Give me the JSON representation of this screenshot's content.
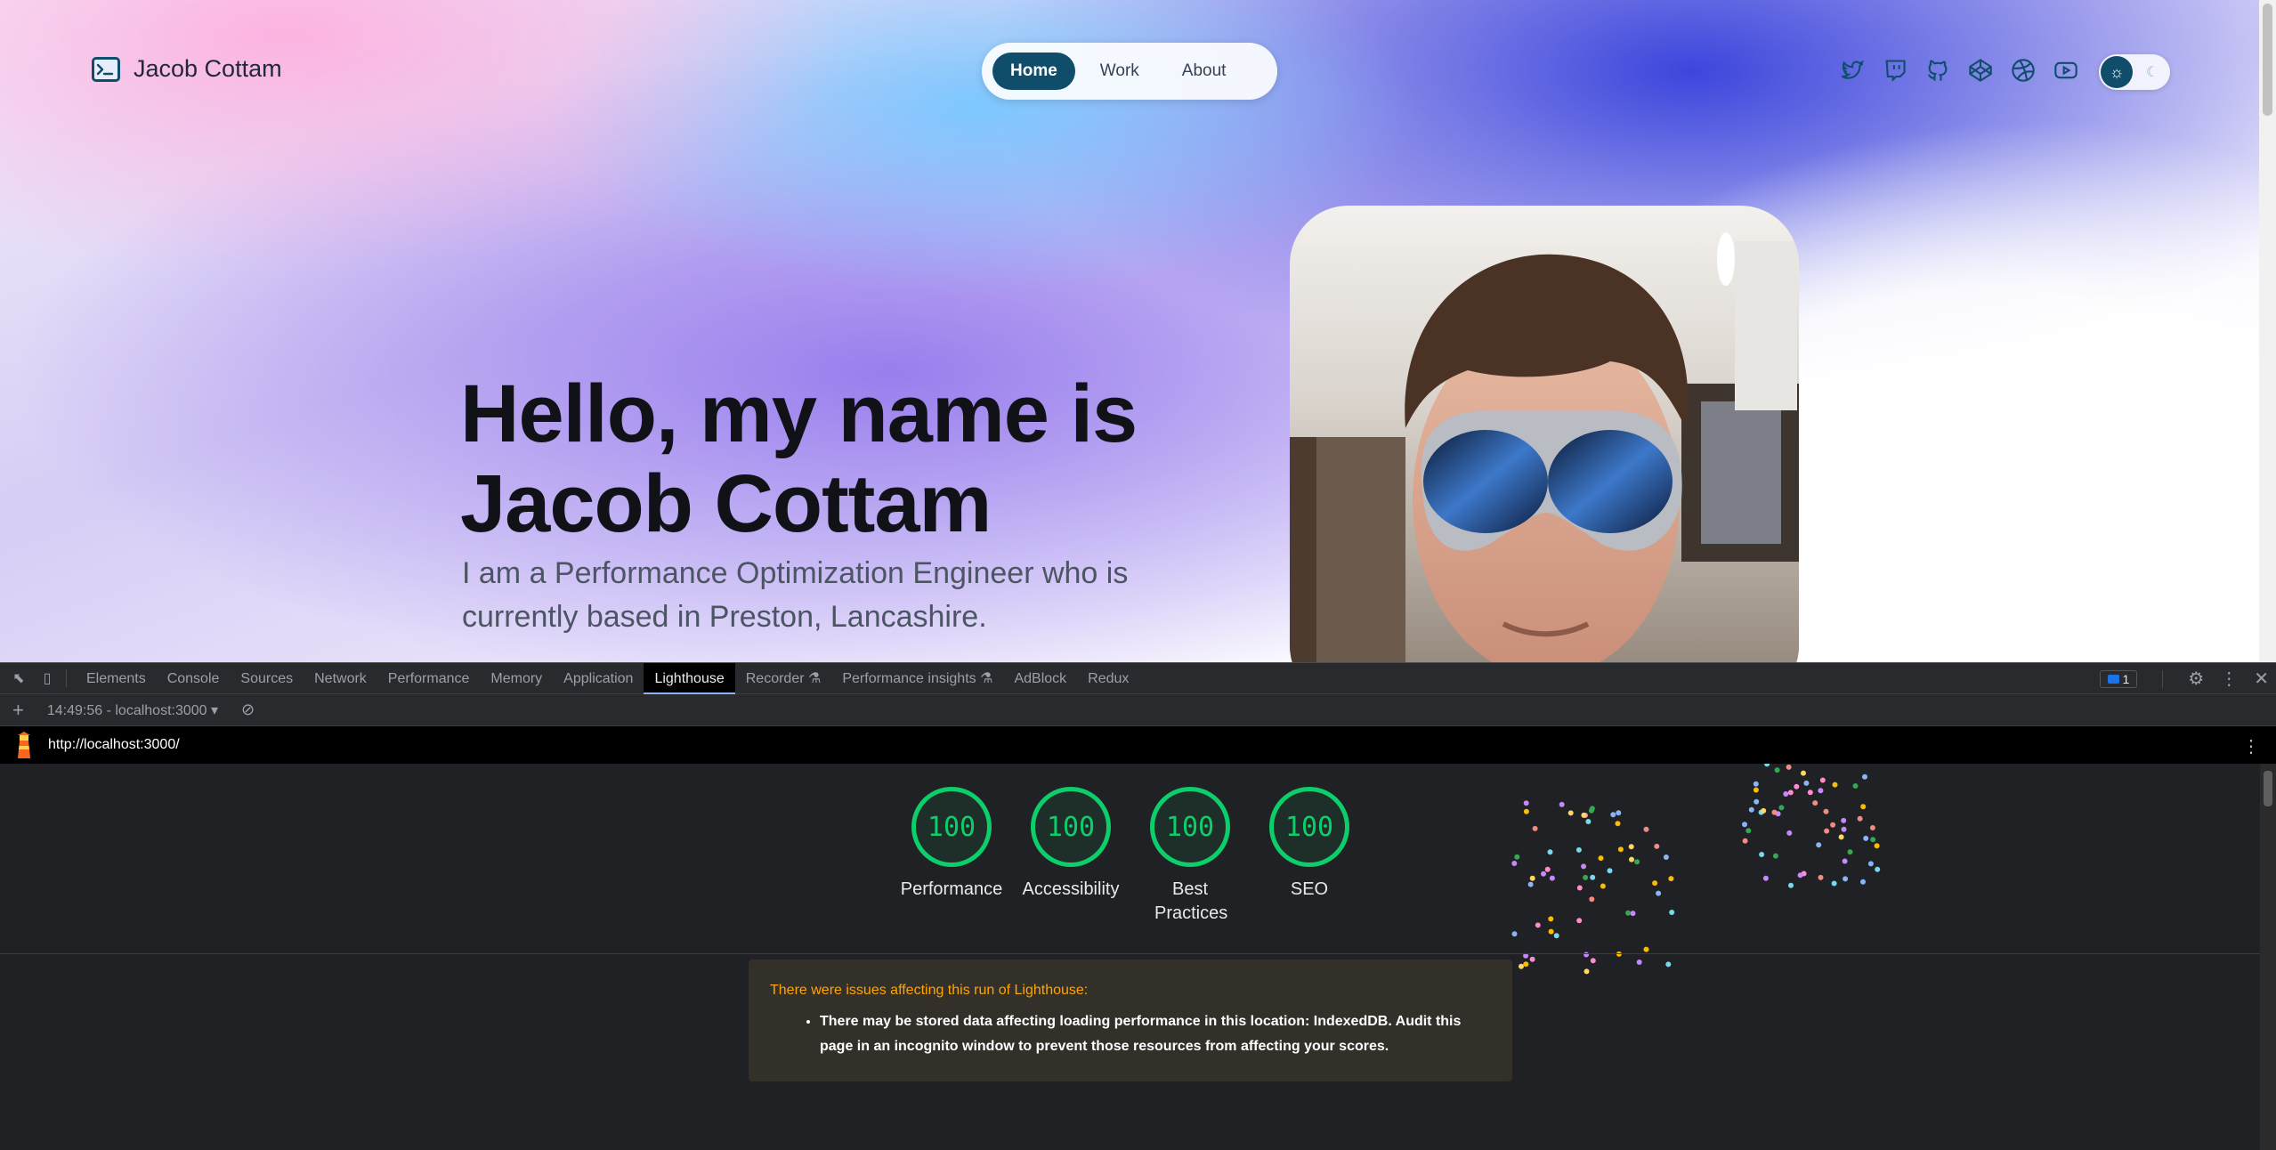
{
  "site": {
    "brand_name": "Jacob Cottam",
    "nav": [
      {
        "label": "Home",
        "active": true
      },
      {
        "label": "Work",
        "active": false
      },
      {
        "label": "About",
        "active": false
      }
    ],
    "socials": [
      "twitter-icon",
      "twitch-icon",
      "github-icon",
      "codepen-icon",
      "dribbble-icon",
      "youtube-icon"
    ],
    "hero_title_line1": "Hello, my name is",
    "hero_title_line2": "Jacob Cottam",
    "hero_subtitle": "I am a Performance Optimization Engineer who is currently based in Preston, Lancashire.",
    "accent_color": "#0f4d6b"
  },
  "devtools": {
    "tabs": [
      "Elements",
      "Console",
      "Sources",
      "Network",
      "Performance",
      "Memory",
      "Application",
      "Lighthouse",
      "Recorder",
      "Performance insights",
      "AdBlock",
      "Redux"
    ],
    "active_tab": "Lighthouse",
    "issues_count": "1",
    "run_label": "14:49:56 - localhost:3000",
    "url": "http://localhost:3000/",
    "scores": [
      {
        "score": "100",
        "label": "Performance"
      },
      {
        "score": "100",
        "label": "Accessibility"
      },
      {
        "score": "100",
        "label": "Best Practices"
      },
      {
        "score": "100",
        "label": "SEO"
      }
    ],
    "score_color": "#0cce6b",
    "warning_title": "There were issues affecting this run of Lighthouse:",
    "warning_item": "There may be stored data affecting loading performance in this location: IndexedDB. Audit this page in an incognito window to prevent those resources from affecting your scores."
  }
}
